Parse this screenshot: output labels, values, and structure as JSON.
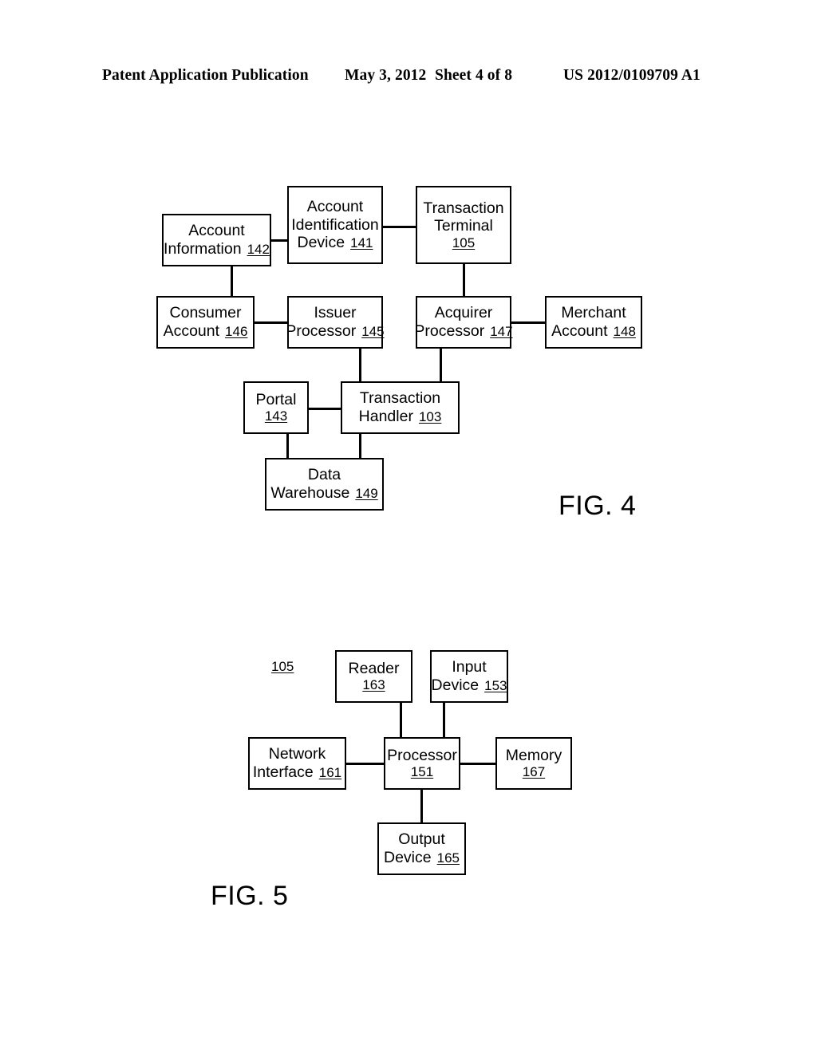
{
  "header": {
    "publication": "Patent Application Publication",
    "date": "May 3, 2012",
    "sheet": "Sheet 4 of 8",
    "number": "US 2012/0109709 A1"
  },
  "figures": [
    {
      "caption": "FIG. 4",
      "nodes": [
        {
          "id": "account-information",
          "line1": "Account",
          "line2": "Information",
          "ref": "142"
        },
        {
          "id": "account-identification-device",
          "line1": "Account",
          "line2": "Identification",
          "line3": "Device",
          "ref": "141"
        },
        {
          "id": "transaction-terminal",
          "line1": "Transaction",
          "line2": "Terminal",
          "ref": "105"
        },
        {
          "id": "consumer-account",
          "line1": "Consumer",
          "line2": "Account",
          "ref": "146"
        },
        {
          "id": "issuer-processor",
          "line1": "Issuer",
          "line2": "Processor",
          "ref": "145"
        },
        {
          "id": "acquirer-processor",
          "line1": "Acquirer",
          "line2": "Processor",
          "ref": "147"
        },
        {
          "id": "merchant-account",
          "line1": "Merchant",
          "line2": "Account",
          "ref": "148"
        },
        {
          "id": "portal",
          "line1": "Portal",
          "ref": "143"
        },
        {
          "id": "transaction-handler",
          "line1": "Transaction",
          "line2": "Handler",
          "ref": "103"
        },
        {
          "id": "data-warehouse",
          "line1": "Data",
          "line2": "Warehouse",
          "ref": "149"
        }
      ],
      "connections": [
        "account-information -- account-identification-device",
        "account-identification-device -- transaction-terminal",
        "account-information -- consumer-account",
        "consumer-account -- issuer-processor",
        "transaction-terminal -- acquirer-processor",
        "acquirer-processor -- merchant-account",
        "issuer-processor -- transaction-handler",
        "acquirer-processor -- transaction-handler",
        "portal -- transaction-handler",
        "portal -- data-warehouse",
        "transaction-handler -- data-warehouse"
      ]
    },
    {
      "caption": "FIG. 5",
      "system_ref": "105",
      "nodes": [
        {
          "id": "reader",
          "line1": "Reader",
          "ref": "163"
        },
        {
          "id": "input-device",
          "line1": "Input",
          "line2": "Device",
          "ref": "153"
        },
        {
          "id": "network-interface",
          "line1": "Network",
          "line2": "Interface",
          "ref": "161"
        },
        {
          "id": "processor",
          "line1": "Processor",
          "ref": "151"
        },
        {
          "id": "memory",
          "line1": "Memory",
          "ref": "167"
        },
        {
          "id": "output-device",
          "line1": "Output",
          "line2": "Device",
          "ref": "165"
        }
      ],
      "connections": [
        "reader -- processor",
        "input-device -- processor",
        "network-interface -- processor",
        "processor -- memory",
        "processor -- output-device"
      ]
    }
  ]
}
